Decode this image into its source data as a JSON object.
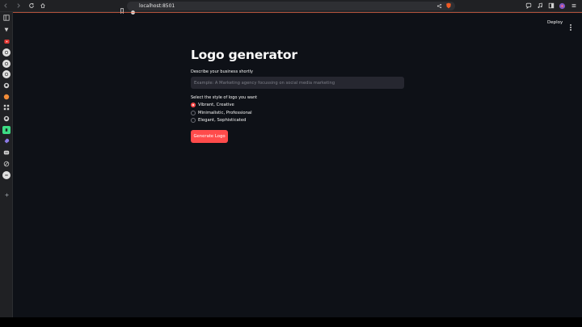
{
  "browser": {
    "url": "localhost:8501"
  },
  "app": {
    "deploy_label": "Deploy",
    "title": "Logo generator",
    "description_label": "Describe your business shortly",
    "description_placeholder": "Example: A Marketing agency focussing on social media marketing",
    "description_value": "",
    "style_label": "Select the style of logo you want",
    "style_options": [
      "Vibrant, Creative",
      "Minimalistic, Professional",
      "Elegant, Sophisticated"
    ],
    "selected_style": "Vibrant, Creative",
    "generate_label": "Generate Logo",
    "accent_color": "#ff4b4b"
  },
  "sidebar": {
    "icons": [
      "sidebar-toggle-icon",
      "tag-icon",
      "youtube-icon",
      "chatgpt-icon",
      "openai-icon",
      "openai-icon",
      "github-icon",
      "brave-icon",
      "grid-icon",
      "github-icon",
      "android-icon",
      "rocket-icon",
      "discord-icon",
      "circle-icon",
      "minus-icon",
      "plus-icon"
    ]
  }
}
